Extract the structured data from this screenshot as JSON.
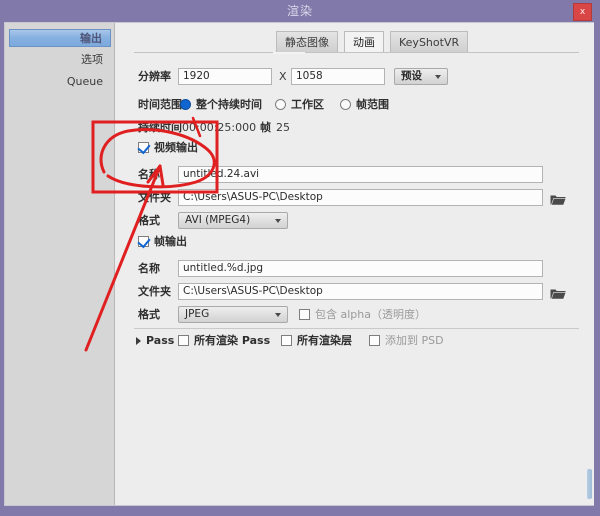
{
  "window": {
    "title": "渲染",
    "close_label": "x"
  },
  "sidebar": {
    "items": [
      {
        "label": "输出",
        "selected": true
      },
      {
        "label": "选项",
        "selected": false
      },
      {
        "label": "Queue",
        "selected": false
      }
    ]
  },
  "tabs": [
    {
      "label": "静态图像",
      "active": false
    },
    {
      "label": "动画",
      "active": true
    },
    {
      "label": "KeyShotVR",
      "active": false
    }
  ],
  "form": {
    "resolution": {
      "label": "分辨率",
      "width": "1920",
      "separator": "X",
      "height": "1058",
      "preset_label": "预设"
    },
    "time_range": {
      "label": "时间范围",
      "options": [
        {
          "label": "整个持续时间",
          "selected": true
        },
        {
          "label": "工作区",
          "selected": false
        },
        {
          "label": "帧范围",
          "selected": false
        }
      ]
    },
    "duration": {
      "label": "持续时间",
      "value": "00:00:25:000",
      "frames_label": "帧",
      "frames_value": "25"
    },
    "video_output": {
      "checkbox_label": "视频输出",
      "checked": true,
      "name_label": "名称",
      "name_value": "untitled.24.avi",
      "folder_label": "文件夹",
      "folder_value": "C:\\Users\\ASUS-PC\\Desktop",
      "format_label": "格式",
      "format_value": "AVI (MPEG4)"
    },
    "frame_output": {
      "checkbox_label": "帧输出",
      "checked": true,
      "name_label": "名称",
      "name_value": "untitled.%d.jpg",
      "folder_label": "文件夹",
      "folder_value": "C:\\Users\\ASUS-PC\\Desktop",
      "format_label": "格式",
      "format_value": "JPEG",
      "alpha_label": "包含 alpha（透明度）",
      "alpha_checked": false
    },
    "pass_row": {
      "label": "Pass",
      "options": [
        {
          "label": "所有渲染 Pass",
          "checked": false,
          "disabled": false
        },
        {
          "label": "所有渲染层",
          "checked": false,
          "disabled": false
        },
        {
          "label": "添加到 PSD",
          "checked": false,
          "disabled": true
        }
      ]
    }
  },
  "annotation": {
    "color": "#e02020",
    "shapes": "rectangle-oval-arrow pointing at 视频输出 checkbox"
  },
  "colors": {
    "titlebar": "#8079aa",
    "close_button": "#d84646",
    "sidebar_selected": "#86b0e0",
    "radio_selected": "#1165d0",
    "annotation_red": "#e02020"
  }
}
